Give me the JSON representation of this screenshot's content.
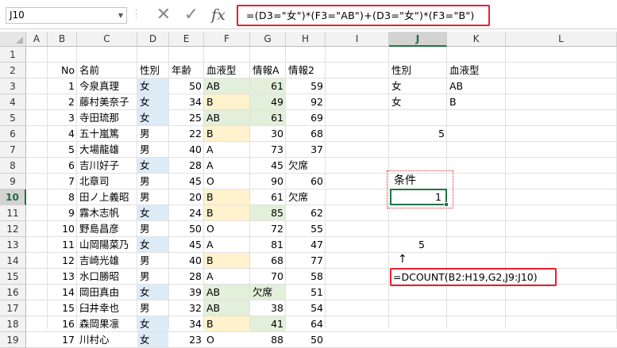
{
  "formula_bar": {
    "name_box": "J10",
    "formula": "=(D3=\"女\")*(F3=\"AB\")+(D3=\"女\")*(F3=\"B\")",
    "cancel_icon": "close-icon",
    "enter_icon": "check-icon",
    "fx_label": "fx"
  },
  "columns": [
    "A",
    "B",
    "C",
    "D",
    "E",
    "F",
    "G",
    "H",
    "I",
    "J",
    "K",
    "L"
  ],
  "selected_column": "J",
  "selected_row": 10,
  "rows": [
    "1",
    "2",
    "3",
    "4",
    "5",
    "6",
    "7",
    "8",
    "9",
    "10",
    "11",
    "12",
    "13",
    "14",
    "15",
    "16",
    "17",
    "18",
    "19"
  ],
  "headers": {
    "no": "No",
    "name": "名前",
    "gender": "性別",
    "age": "年齢",
    "blood": "血液型",
    "info_a": "情報A",
    "info2": "情報2"
  },
  "table_rows": [
    {
      "no": "1",
      "name": "今泉真理",
      "gender": "女",
      "age": "50",
      "blood": "AB",
      "info_a": "61",
      "info2": "59"
    },
    {
      "no": "2",
      "name": "藤村美奈子",
      "gender": "女",
      "age": "34",
      "blood": "B",
      "info_a": "49",
      "info2": "92"
    },
    {
      "no": "3",
      "name": "寺田琉那",
      "gender": "女",
      "age": "25",
      "blood": "AB",
      "info_a": "61",
      "info2": "69"
    },
    {
      "no": "4",
      "name": "五十嵐篤",
      "gender": "男",
      "age": "22",
      "blood": "B",
      "info_a": "30",
      "info2": "68"
    },
    {
      "no": "5",
      "name": "大場龍雄",
      "gender": "男",
      "age": "40",
      "blood": "A",
      "info_a": "73",
      "info2": "37"
    },
    {
      "no": "6",
      "name": "吉川好子",
      "gender": "女",
      "age": "28",
      "blood": "A",
      "info_a": "45",
      "info2": "欠席"
    },
    {
      "no": "7",
      "name": "北章司",
      "gender": "男",
      "age": "45",
      "blood": "O",
      "info_a": "90",
      "info2": "60"
    },
    {
      "no": "8",
      "name": "田ノ上義昭",
      "gender": "男",
      "age": "20",
      "blood": "B",
      "info_a": "61",
      "info2": "欠席"
    },
    {
      "no": "9",
      "name": "霧木志帆",
      "gender": "女",
      "age": "24",
      "blood": "B",
      "info_a": "85",
      "info2": "62"
    },
    {
      "no": "10",
      "name": "野島昌彦",
      "gender": "男",
      "age": "50",
      "blood": "O",
      "info_a": "72",
      "info2": "55"
    },
    {
      "no": "11",
      "name": "山岡陽菜乃",
      "gender": "女",
      "age": "45",
      "blood": "A",
      "info_a": "81",
      "info2": "47"
    },
    {
      "no": "12",
      "name": "吉崎光雄",
      "gender": "男",
      "age": "40",
      "blood": "B",
      "info_a": "68",
      "info2": "77"
    },
    {
      "no": "13",
      "name": "水口勝昭",
      "gender": "男",
      "age": "28",
      "blood": "A",
      "info_a": "70",
      "info2": "58"
    },
    {
      "no": "14",
      "name": "岡田真由",
      "gender": "女",
      "age": "39",
      "blood": "AB",
      "info_a": "欠席",
      "info2": "51"
    },
    {
      "no": "15",
      "name": "臼井幸也",
      "gender": "男",
      "age": "32",
      "blood": "AB",
      "info_a": "38",
      "info2": "54"
    },
    {
      "no": "16",
      "name": "森岡果凛",
      "gender": "女",
      "age": "34",
      "blood": "B",
      "info_a": "41",
      "info2": "64"
    },
    {
      "no": "17",
      "name": "川村心",
      "gender": "女",
      "age": "23",
      "blood": "O",
      "info_a": "88",
      "info2": "50"
    }
  ],
  "criteria": {
    "j2": "性別",
    "k2": "血液型",
    "j3": "女",
    "k3": "AB",
    "j4": "女",
    "k4": "B",
    "j6": "5",
    "j9": "条件",
    "j10": "1",
    "j13": "5",
    "j14": "↑",
    "j15": "=DCOUNT(B2:H19,G2,J9:J10)"
  },
  "colors": {
    "gender_female_fill": "#ddebf7",
    "blood_ab_fill": "#e2efda",
    "blood_b_fill": "#fff2cc",
    "info_fill": "#e2efda",
    "highlight_red": "#e8202e",
    "excel_green": "#217346"
  }
}
